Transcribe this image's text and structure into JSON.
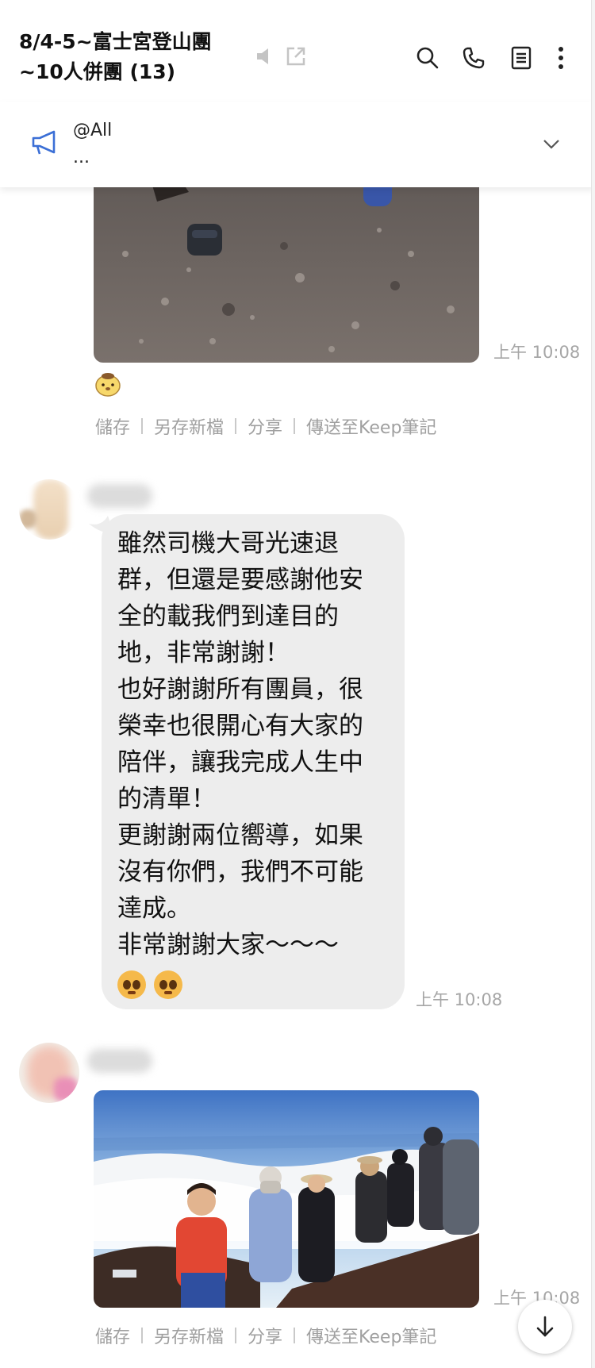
{
  "header": {
    "title_line1": "8/4-5~富士宮登山團",
    "title_line2": "~10人併團 (13)",
    "icons": [
      "mute-icon",
      "popout-icon",
      "search-icon",
      "phone-icon",
      "notes-icon",
      "more-icon"
    ]
  },
  "announcement": {
    "line1": "@All",
    "line2": "..."
  },
  "messages": {
    "photo1": {
      "time": "上午 10:08"
    },
    "actions1": {
      "save": "儲存",
      "save_as": "另存新檔",
      "share": "分享",
      "keep": "傳送至Keep筆記"
    },
    "text_message": {
      "lines": [
        "雖然司機大哥光速退",
        "群，但還是要感謝他安",
        "全的載我們到達目的",
        "地，非常謝謝！",
        "也好謝謝所有團員，很",
        "榮幸也很開心有大家的",
        "陪伴，讓我完成人生中",
        "的清單！",
        "更謝謝兩位嚮導，如果",
        "沒有你們，我們不可能",
        "達成。",
        "非常謝謝大家～～～"
      ],
      "time": "上午 10:08"
    },
    "photo2": {
      "time": "上午 10:08"
    },
    "actions2": {
      "save": "儲存",
      "save_as": "另存新檔",
      "share": "分享",
      "keep": "傳送至Keep筆記"
    }
  },
  "colors": {
    "bubble": "#ededed",
    "meta_text": "#a6a6a6",
    "announce_icon": "#3b6fd6"
  }
}
